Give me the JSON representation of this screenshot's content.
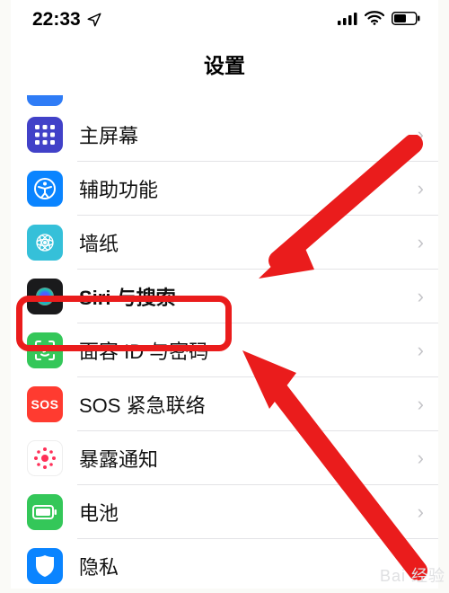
{
  "status": {
    "time": "22:33"
  },
  "title": "设置",
  "rows": {
    "r0_label": "主屏幕",
    "r1_label": "辅助功能",
    "r2_label": "墙纸",
    "r3_label": "Siri 与搜索",
    "r4_label": "面容 ID 与密码",
    "r5_label": "SOS 紧急联络",
    "r6_label": "暴露通知",
    "r7_label": "电池",
    "r8_label": "隐私"
  },
  "icons": {
    "sos_text": "SOS"
  },
  "watermark": "Bai 经验"
}
